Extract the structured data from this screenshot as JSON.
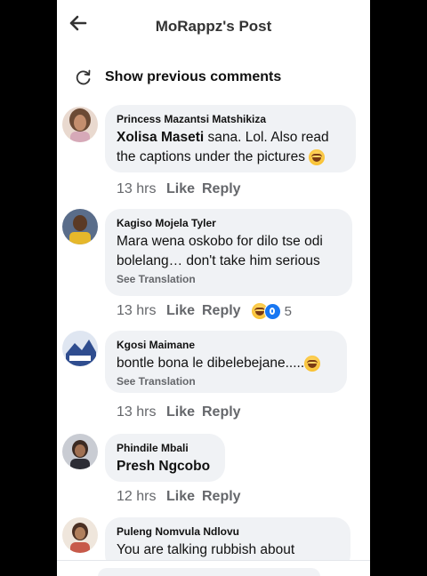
{
  "header": {
    "title": "MoRappz's Post",
    "back_icon": "arrow-left-icon"
  },
  "previous_comments": {
    "label": "Show previous comments",
    "icon": "refresh-icon"
  },
  "reactions": {
    "laugh_icon": "laugh-emoji-icon",
    "wow_icon": "wow-emoji-icon"
  },
  "actions": {
    "like": "Like",
    "reply": "Reply"
  },
  "comments": [
    {
      "author": "Princess Mazantsi Matshikiza",
      "mention": "Xolisa Maseti",
      "text": " sana. Lol. Also read the captions under the pictures",
      "time": "13 hrs"
    },
    {
      "author": "Kagiso Mojela Tyler",
      "text": "Mara wena oskobo for dilo tse odi bolelang… don't take him serious",
      "see_translation": "See Translation",
      "time": "13 hrs",
      "reaction_count": "5"
    },
    {
      "author": "Kgosi Maimane",
      "text": "bontle bona le dibelebejane.....",
      "see_translation": "See Translation",
      "time": "13 hrs"
    },
    {
      "author": "Phindile Mbali",
      "text": "Presh Ngcobo",
      "time": "12 hrs"
    },
    {
      "author": "Puleng Nomvula Ndlovu",
      "text": "You are talking rubbish about"
    }
  ],
  "colors": {
    "bubble": "#f0f2f5",
    "meta_text": "#65676b",
    "accent_blue": "#1877f2"
  }
}
